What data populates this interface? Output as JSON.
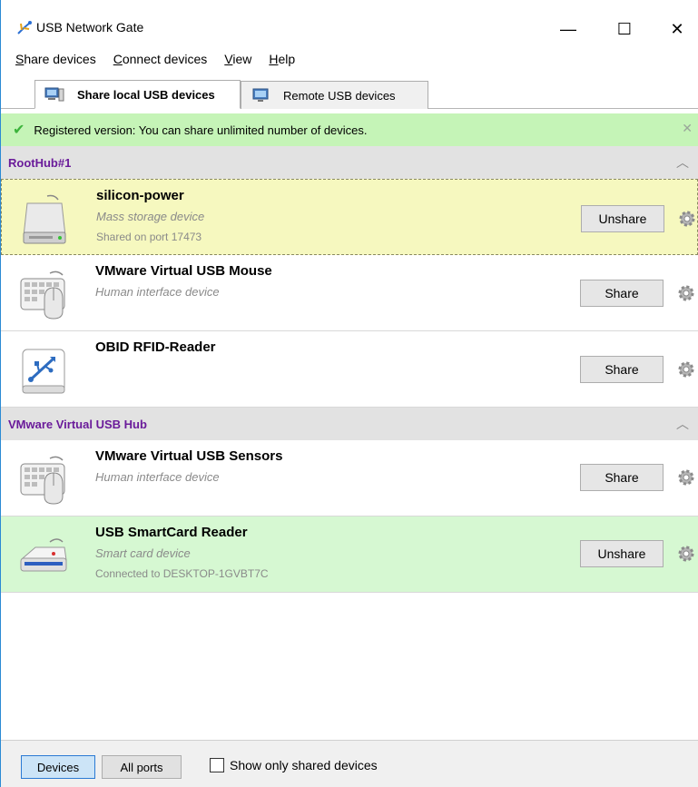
{
  "window": {
    "title": "USB Network Gate",
    "minimize_glyph": "—",
    "maximize_glyph": "☐",
    "close_glyph": "✕"
  },
  "menu": [
    {
      "label": "Share devices",
      "accel": "S",
      "rest": "hare devices"
    },
    {
      "label": "Connect devices",
      "accel": "C",
      "rest": "onnect devices"
    },
    {
      "label": "View",
      "accel": "V",
      "rest": "iew"
    },
    {
      "label": "Help",
      "accel": "H",
      "rest": "elp"
    }
  ],
  "tabs": {
    "local": "Share local USB devices",
    "remote": "Remote USB devices"
  },
  "banner": {
    "text": "Registered version: You can share unlimited number of devices.",
    "check_color": "#3cb43c",
    "background": "#c5f4b7"
  },
  "groups": [
    {
      "name": "RootHub#1",
      "devices": [
        {
          "name": "silicon-power",
          "type": "Mass storage device",
          "status": "Shared on port 17473",
          "action": "Unshare",
          "icon": "hard-drive-icon",
          "state": "shared"
        },
        {
          "name": "VMware Virtual USB Mouse",
          "type": "Human interface device",
          "status": "",
          "action": "Share",
          "icon": "keyboard-mouse-icon",
          "state": "idle"
        },
        {
          "name": "OBID RFID-Reader",
          "type": "",
          "status": "",
          "action": "Share",
          "icon": "usb-icon",
          "state": "idle"
        }
      ]
    },
    {
      "name": "VMware Virtual USB Hub",
      "devices": [
        {
          "name": "VMware Virtual USB Sensors",
          "type": "Human interface device",
          "status": "",
          "action": "Share",
          "icon": "keyboard-mouse-icon",
          "state": "idle"
        },
        {
          "name": "USB SmartCard Reader",
          "type": "Smart card device",
          "status": "Connected to DESKTOP-1GVBT7C",
          "action": "Unshare",
          "icon": "smartcard-reader-icon",
          "state": "connected"
        }
      ]
    }
  ],
  "footer": {
    "devices_label": "Devices",
    "all_ports_label": "All ports",
    "show_shared_label": "Show only shared devices",
    "show_shared_checked": false
  },
  "colors": {
    "group_text": "#6a1b9a",
    "shared_row": "#f6f8bf",
    "connected_row": "#d6f8d2"
  }
}
